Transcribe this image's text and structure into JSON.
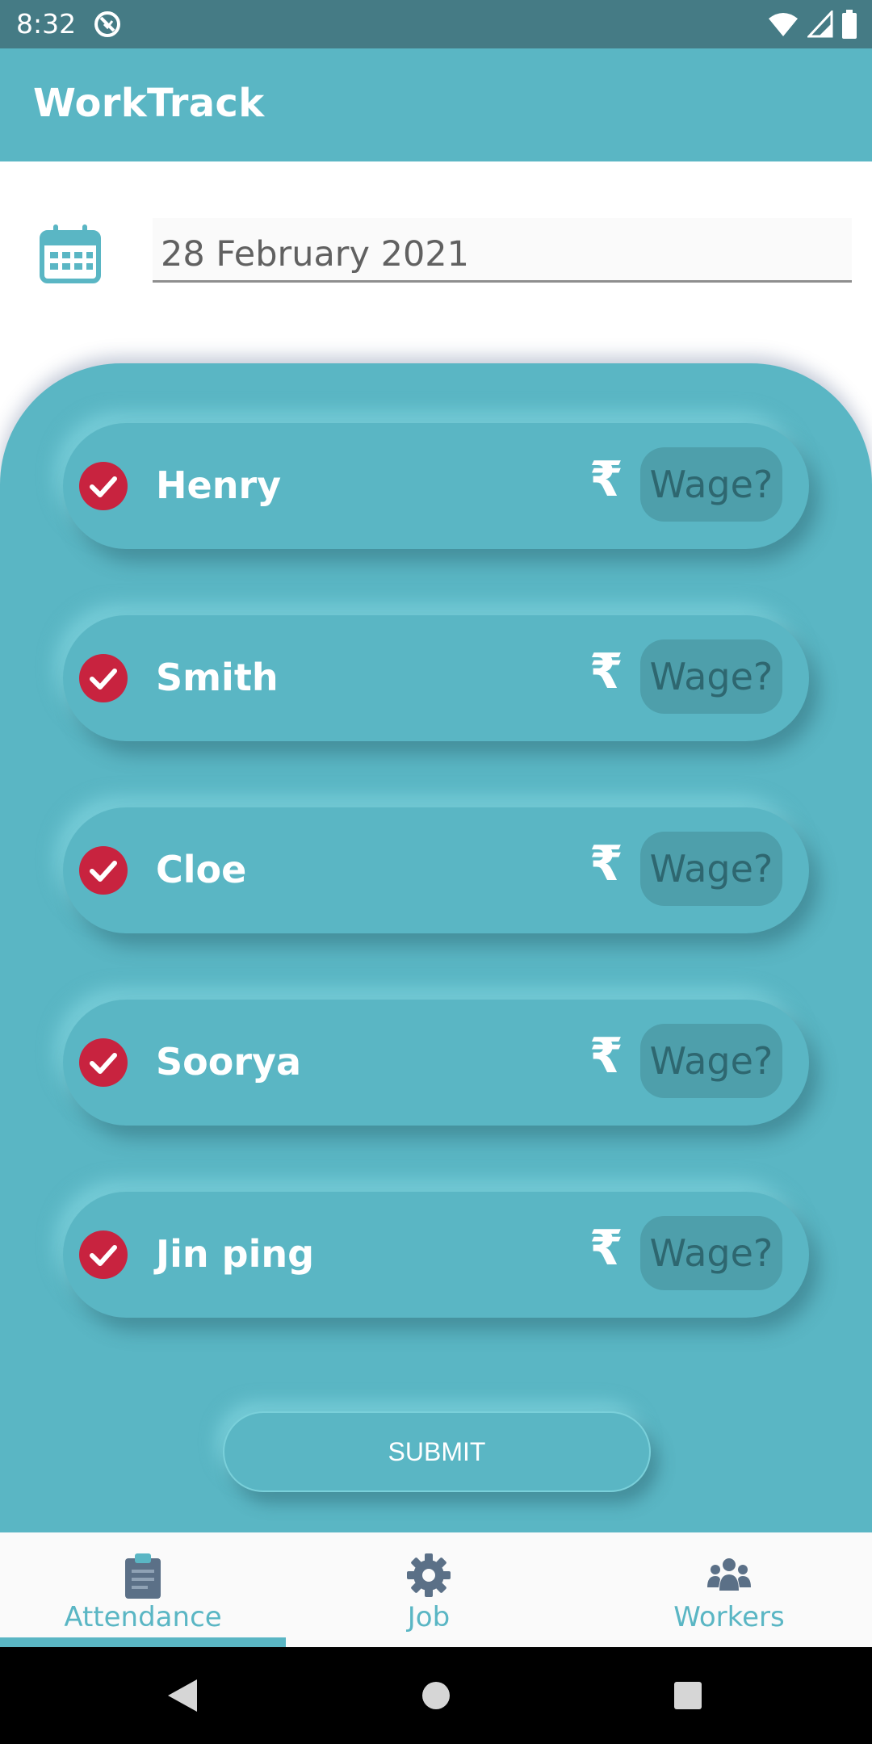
{
  "status_bar": {
    "time": "8:32"
  },
  "app_bar": {
    "title": "WorkTrack"
  },
  "date": {
    "value": "28 February 2021"
  },
  "workers": [
    {
      "name": "Henry",
      "present": true,
      "wage_placeholder": "Wage?",
      "currency": "₹"
    },
    {
      "name": "Smith",
      "present": true,
      "wage_placeholder": "Wage?",
      "currency": "₹"
    },
    {
      "name": "Cloe",
      "present": true,
      "wage_placeholder": "Wage?",
      "currency": "₹"
    },
    {
      "name": "Soorya",
      "present": true,
      "wage_placeholder": "Wage?",
      "currency": "₹"
    },
    {
      "name": "Jin ping",
      "present": true,
      "wage_placeholder": "Wage?",
      "currency": "₹"
    }
  ],
  "submit_label": "SUBMIT",
  "bottom_nav": {
    "items": [
      {
        "label": "Attendance",
        "icon": "clipboard-icon",
        "active": true
      },
      {
        "label": "Job",
        "icon": "gear-icon",
        "active": false
      },
      {
        "label": "Workers",
        "icon": "group-icon",
        "active": false
      }
    ]
  },
  "colors": {
    "primary": "#5ab6c4",
    "status_bar": "#457b85",
    "check": "#c8233f",
    "nav_icon": "#5b7087"
  }
}
